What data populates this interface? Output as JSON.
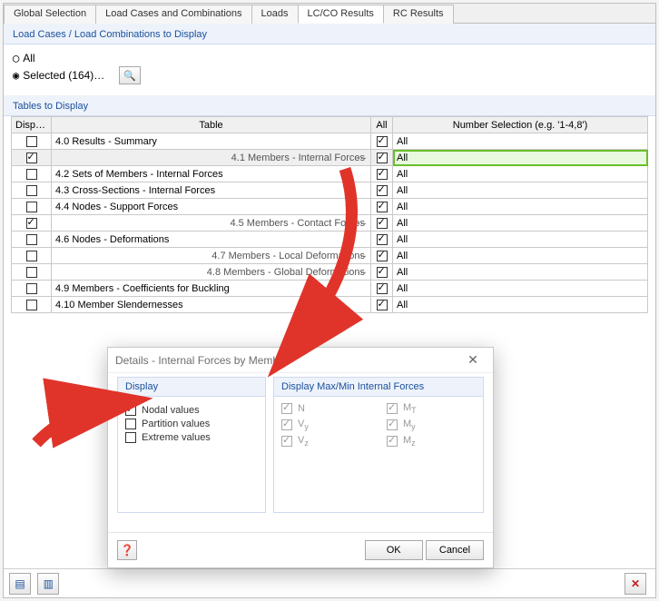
{
  "tabs": {
    "items": [
      "Global Selection",
      "Load Cases and Combinations",
      "Loads",
      "LC/CO Results",
      "RC Results"
    ],
    "active_index": 3
  },
  "load_cases": {
    "section_title": "Load Cases / Load Combinations to Display",
    "option_all": "All",
    "option_selected": "Selected (164)…",
    "selected_count": 164,
    "mode": "selected"
  },
  "tables_section": {
    "title": "Tables to Display",
    "headers": {
      "display": "Display",
      "table": "Table",
      "all": "All",
      "selection": "Number Selection (e.g. '1-4,8')"
    },
    "selected_row": 1,
    "rows": [
      {
        "display": false,
        "name": "4.0 Results - Summary",
        "dots": false,
        "all": true,
        "sel": "All"
      },
      {
        "display": true,
        "name": "4.1 Members - Internal Forces",
        "dots": true,
        "all": true,
        "sel": "All"
      },
      {
        "display": false,
        "name": "4.2 Sets of Members - Internal Forces",
        "dots": false,
        "all": true,
        "sel": "All"
      },
      {
        "display": false,
        "name": "4.3 Cross-Sections - Internal Forces",
        "dots": false,
        "all": true,
        "sel": "All"
      },
      {
        "display": false,
        "name": "4.4 Nodes - Support Forces",
        "dots": false,
        "all": true,
        "sel": "All"
      },
      {
        "display": true,
        "name": "4.5 Members - Contact Forces",
        "dots": true,
        "all": true,
        "sel": "All"
      },
      {
        "display": false,
        "name": "4.6 Nodes - Deformations",
        "dots": false,
        "all": true,
        "sel": "All"
      },
      {
        "display": false,
        "name": "4.7 Members - Local Deformations",
        "dots": true,
        "all": true,
        "sel": "All"
      },
      {
        "display": false,
        "name": "4.8 Members - Global Deformations",
        "dots": true,
        "all": true,
        "sel": "All"
      },
      {
        "display": false,
        "name": "4.9 Members - Coefficients for Buckling",
        "dots": false,
        "all": true,
        "sel": "All"
      },
      {
        "display": false,
        "name": "4.10 Member Slendernesses",
        "dots": false,
        "all": true,
        "sel": "All"
      }
    ]
  },
  "dialog": {
    "title": "Details - Internal Forces by Member",
    "display_group_title": "Display",
    "forces_group_title": "Display Max/Min Internal Forces",
    "options": {
      "nodal": {
        "label": "Nodal values",
        "checked": true
      },
      "partition": {
        "label": "Partition values",
        "checked": false
      },
      "extreme": {
        "label": "Extreme values",
        "checked": false
      }
    },
    "forces": {
      "n": {
        "label": "N",
        "checked": true
      },
      "mt": {
        "label": "M",
        "sub": "T",
        "checked": true
      },
      "vy": {
        "label": "V",
        "sub": "y",
        "checked": true
      },
      "my": {
        "label": "M",
        "sub": "y",
        "checked": true
      },
      "vz": {
        "label": "V",
        "sub": "z",
        "checked": true
      },
      "mz": {
        "label": "M",
        "sub": "z",
        "checked": true
      }
    },
    "ok": "OK",
    "cancel": "Cancel"
  },
  "footer": {
    "delete_tooltip": "Delete"
  }
}
